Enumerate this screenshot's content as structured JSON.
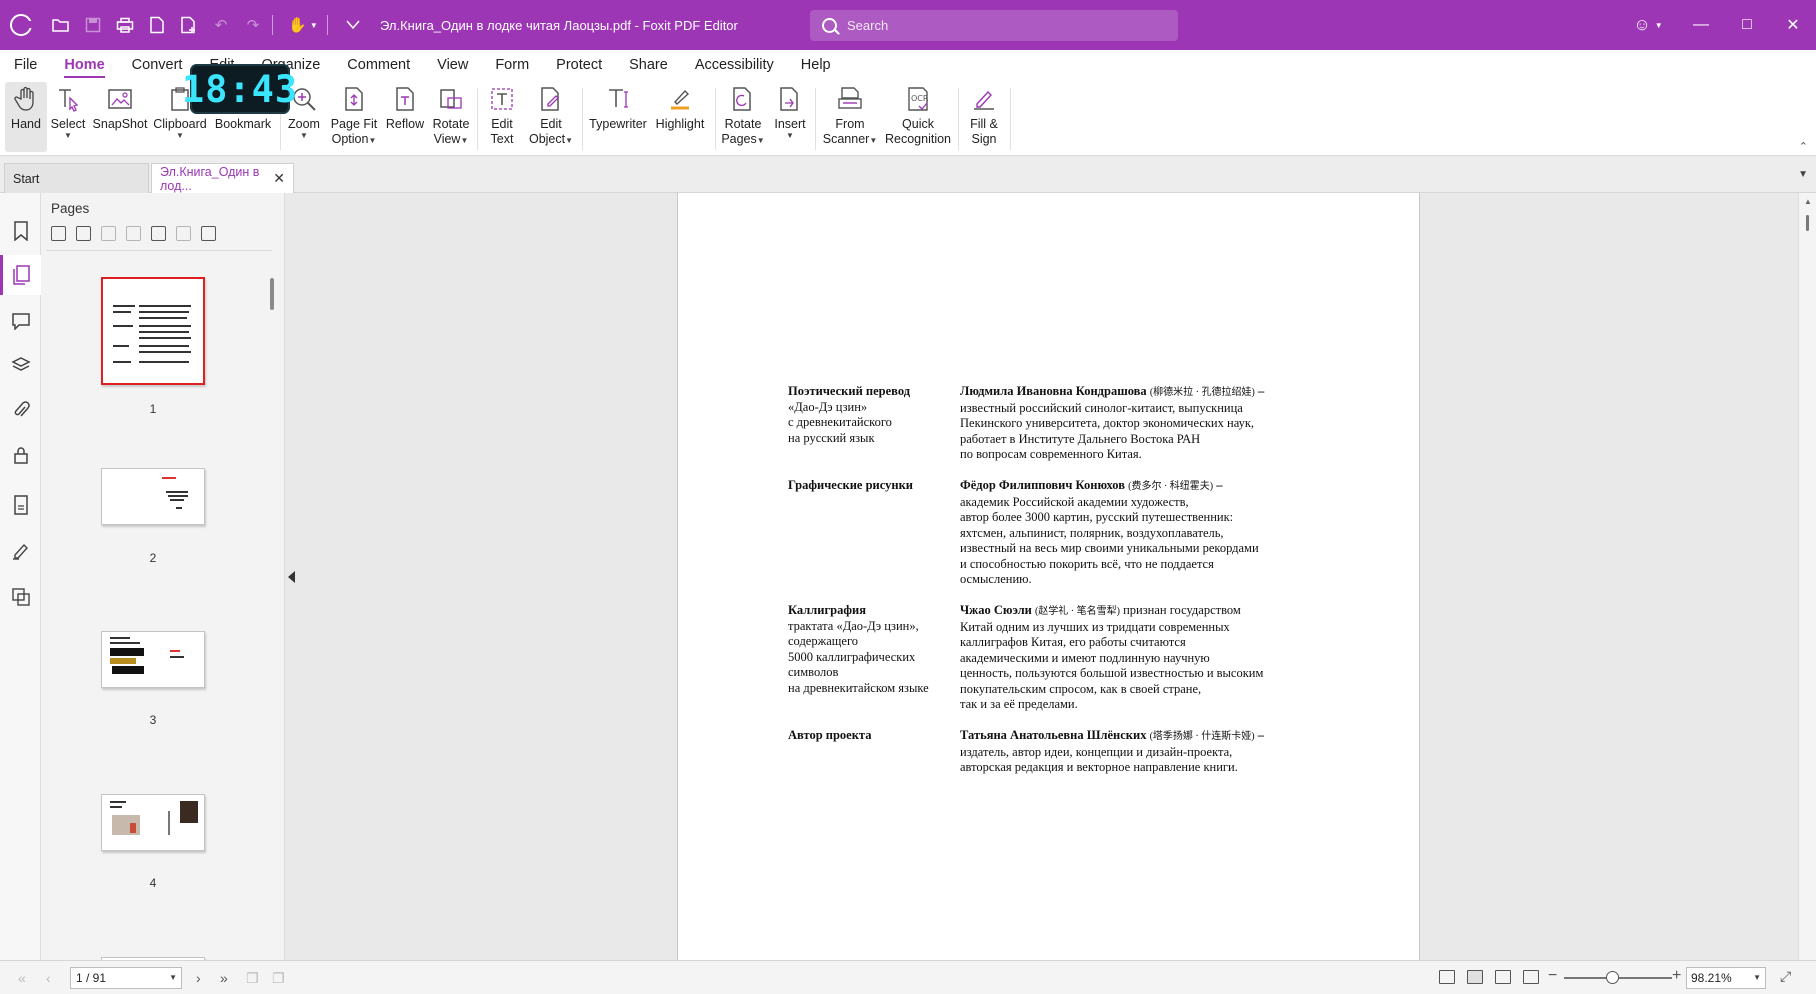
{
  "window": {
    "title": "Эл.Книга_Один в лодке читая Лаоцзы.pdf - Foxit PDF Editor",
    "search_placeholder": "Search",
    "accent": "#9c36b5"
  },
  "menu": {
    "tabs": [
      "File",
      "Home",
      "Convert",
      "Edit",
      "Organize",
      "Comment",
      "View",
      "Form",
      "Protect",
      "Share",
      "Accessibility",
      "Help"
    ],
    "active": "Home"
  },
  "ribbon": {
    "hand": "Hand",
    "select": "Select",
    "snapshot": "SnapShot",
    "clipboard": "Clipboard",
    "bookmark": "Bookmark",
    "zoom": "Zoom",
    "page_fit_1": "Page Fit",
    "page_fit_2": "Option",
    "reflow": "Reflow",
    "rotate_view_1": "Rotate",
    "rotate_view_2": "View",
    "edit_text_1": "Edit",
    "edit_text_2": "Text",
    "edit_object_1": "Edit",
    "edit_object_2": "Object",
    "typewriter": "Typewriter",
    "highlight": "Highlight",
    "rotate_pages_1": "Rotate",
    "rotate_pages_2": "Pages",
    "insert": "Insert",
    "from_scanner_1": "From",
    "from_scanner_2": "Scanner",
    "quick_recog_1": "Quick",
    "quick_recog_2": "Recognition",
    "fill_sign_1": "Fill &",
    "fill_sign_2": "Sign"
  },
  "clock": "18:43",
  "doc_tabs": {
    "start": "Start",
    "document": "Эл.Книга_Один в лод..."
  },
  "pages_panel": {
    "title": "Pages",
    "thumbnails": [
      "1",
      "2",
      "3",
      "4"
    ]
  },
  "document": {
    "credits": [
      {
        "role_title": "Поэтический перевод",
        "role_lines": [
          "«Дао-Дэ цзин»",
          "с древнекитайского",
          "на русский язык"
        ],
        "name": "Людмила Ивановна Кондрашова",
        "cn": "(柳德米拉 · 孔德拉绍娃)",
        "dash": " –",
        "desc_lines": [
          "известный российский синолог-китаист, выпускница",
          "Пекинского университета, доктор экономических наук,",
          "работает в Институте Дальнего Востока РАН",
          "по вопросам современного Китая."
        ]
      },
      {
        "role_title": "Графические рисунки",
        "role_lines": [],
        "name": "Фёдор Филиппович Конюхов",
        "cn": "(费多尔 · 科纽霍夫)",
        "dash": " –",
        "desc_lines": [
          "академик Российской академии художеств,",
          "автор более 3000 картин, русский путешественник:",
          "яхтсмен, альпинист, полярник, воздухоплаватель,",
          "известный на весь мир своими уникальными рекордами",
          "и способностью покорить всё, что не поддается",
          "осмыслению."
        ]
      },
      {
        "role_title": "Каллиграфия",
        "role_lines": [
          "трактата «Дао-Дэ цзин»,",
          "содержащего",
          "5000 каллиграфических",
          "символов",
          "на древнекитайском языке"
        ],
        "name": "Чжао Сюэли",
        "cn": "(赵学礼 · 笔名雪犁)",
        "dash": " признан государством",
        "desc_lines": [
          "Китай одним из лучших из тридцати современных",
          "каллиграфов Китая, его работы считаются",
          "академическими и имеют подлинную научную",
          "ценность, пользуются большой известностью и высоким",
          "покупательским спросом, как в своей стране,",
          "так и за её пределами."
        ]
      },
      {
        "role_title": "Автор проекта",
        "role_lines": [],
        "name": "Татьяна Анатольевна Шлёнских",
        "cn": "(塔季扬娜 · 什连斯卡娅)",
        "dash": " –",
        "desc_lines": [
          "издатель, автор идеи, концепции и дизайн-проекта,",
          "авторская редакция и векторное направление книги."
        ]
      }
    ]
  },
  "status": {
    "page": "1 / 91",
    "zoom": "98.21%"
  }
}
